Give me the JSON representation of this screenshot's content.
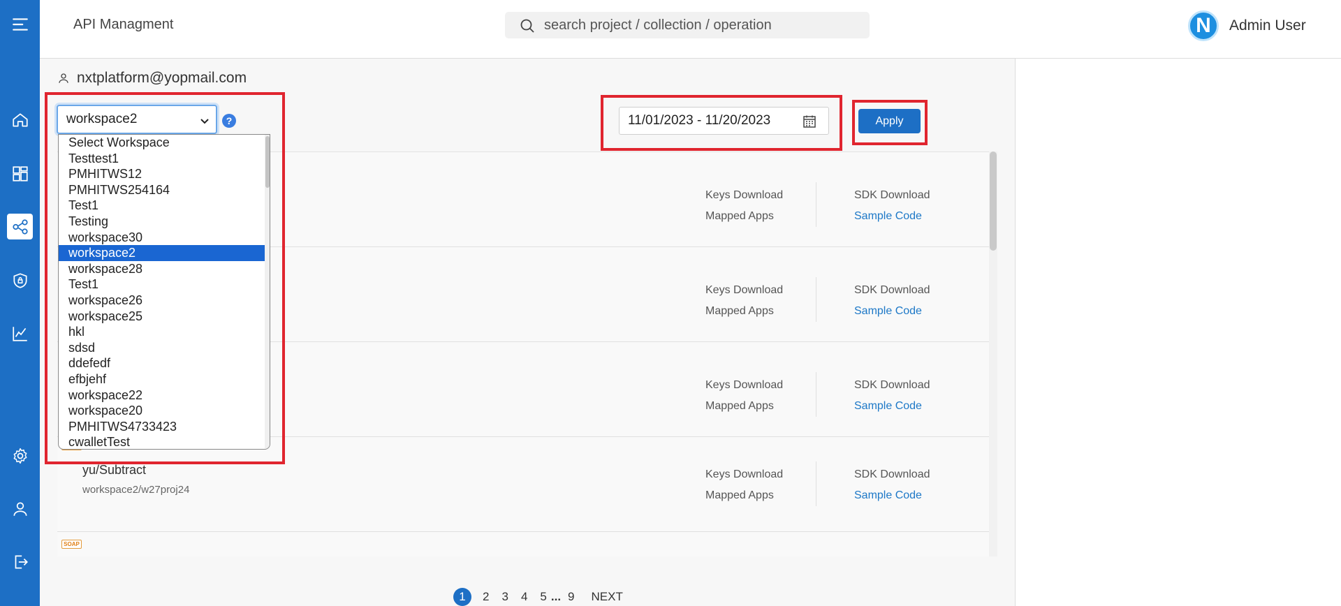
{
  "app": {
    "title": "API Managment"
  },
  "search": {
    "placeholder": "search project / collection / operation"
  },
  "user": {
    "avatar_letter": "N",
    "name": "Admin User"
  },
  "account": {
    "email": "nxtplatform@yopmail.com"
  },
  "workspace_select": {
    "selected": "workspace2",
    "help_glyph": "?",
    "options": [
      "Select Workspace",
      "Testtest1",
      "PMHITWS12",
      "PMHITWS254164",
      "Test1",
      "Testing",
      "workspace30",
      "workspace2",
      "workspace28",
      "Test1",
      "workspace26",
      "workspace25",
      "hkl",
      "sdsd",
      "ddefedf",
      "efbjehf",
      "workspace22",
      "workspace20",
      "PMHITWS4733423",
      "cwalletTest"
    ]
  },
  "date_range": {
    "value": "11/01/2023 - 11/20/2023"
  },
  "apply": {
    "label": "Apply"
  },
  "list": {
    "badge": "SOAP",
    "rows": [
      {
        "keys": "Keys Download",
        "sdk": "SDK Download",
        "mapped": "Mapped Apps",
        "sample": "Sample Code"
      },
      {
        "keys": "Keys Download",
        "sdk": "SDK Download",
        "mapped": "Mapped Apps",
        "sample": "Sample Code"
      },
      {
        "keys": "Keys Download",
        "sdk": "SDK Download",
        "mapped": "Mapped Apps",
        "sample": "Sample Code"
      },
      {
        "title": "yu/Subtract",
        "subtitle": "workspace2/w27proj24",
        "keys": "Keys Download",
        "sdk": "SDK Download",
        "mapped": "Mapped Apps",
        "sample": "Sample Code"
      }
    ]
  },
  "pagination": {
    "pages": [
      "1",
      "2",
      "3",
      "4",
      "5"
    ],
    "ellipsis": "...",
    "last": "9",
    "next": "NEXT",
    "current": "1"
  },
  "colors": {
    "sidebar": "#1d6fc5",
    "highlight": "#e0252f",
    "link": "#1d78c7",
    "badge": "#e07f14"
  },
  "icons": [
    "menu-icon",
    "home-icon",
    "dashboard-icon",
    "api-network-icon",
    "shield-icon",
    "analytics-icon",
    "settings-icon",
    "user-icon",
    "logout-icon",
    "search-icon",
    "person-icon",
    "chevron-down-icon",
    "calendar-icon",
    "help-icon"
  ]
}
